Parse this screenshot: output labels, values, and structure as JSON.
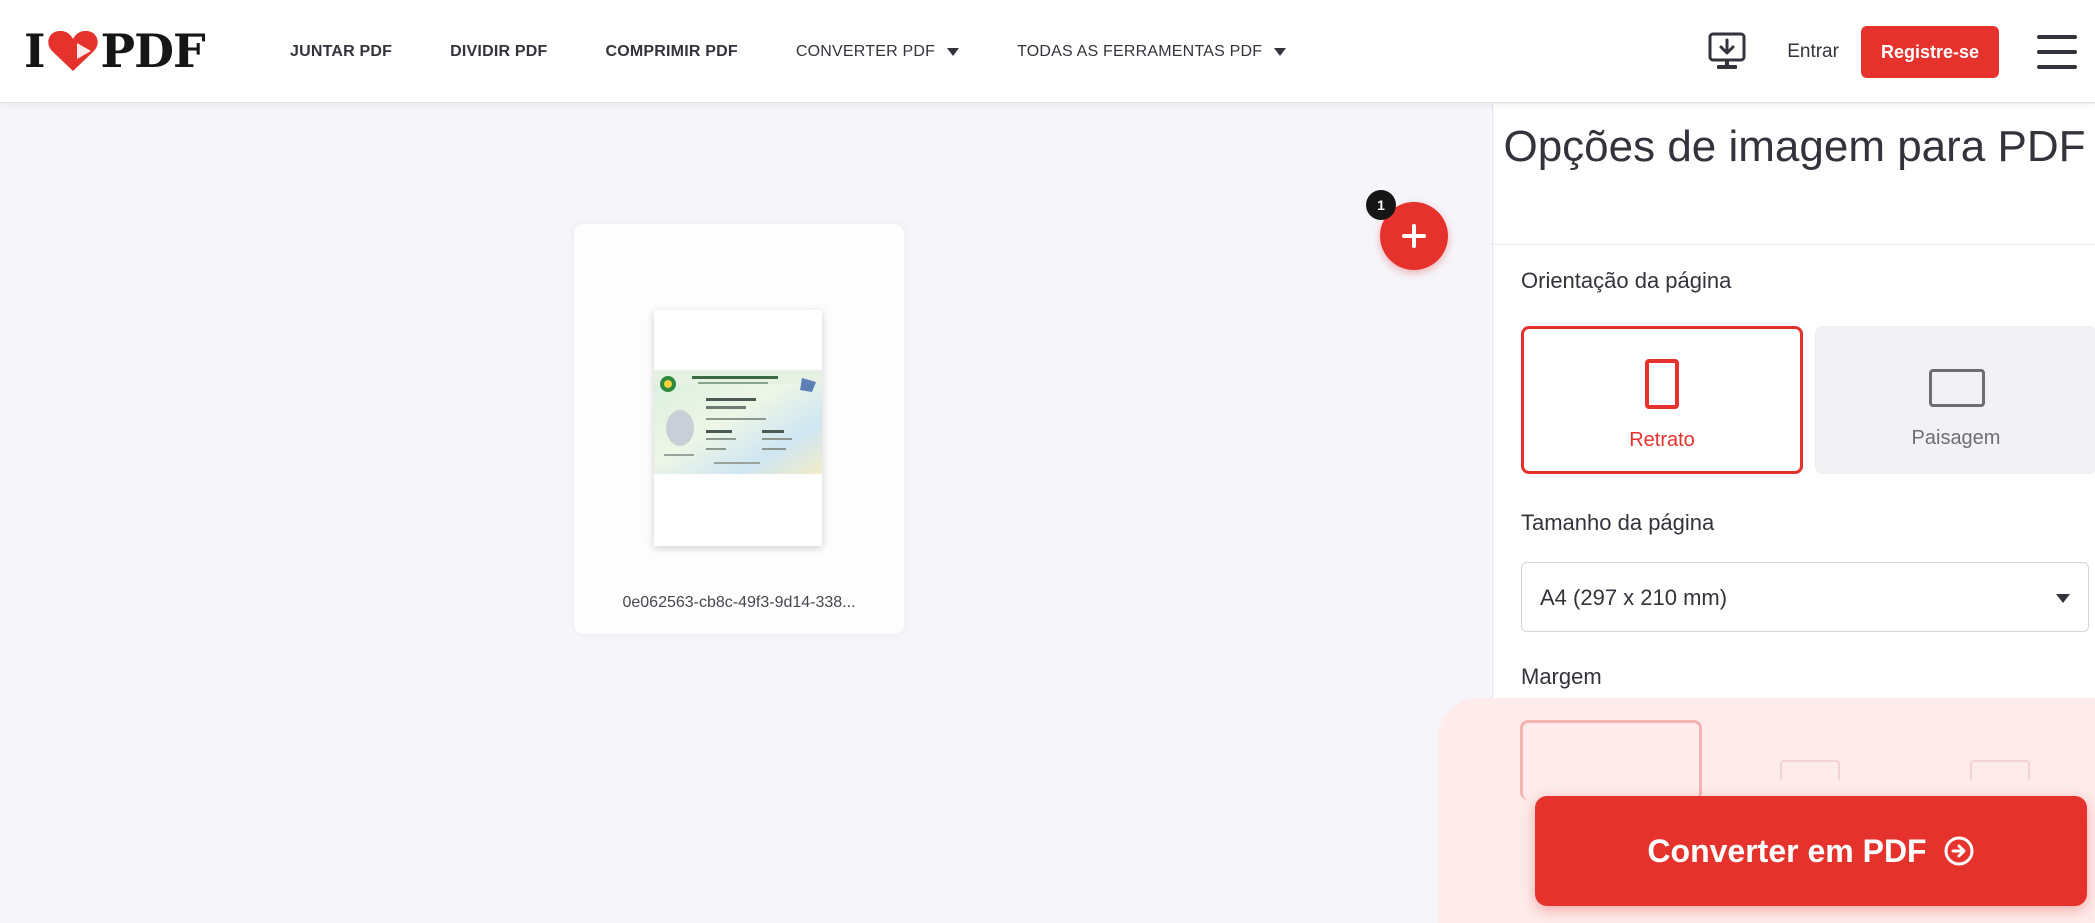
{
  "header": {
    "logo": {
      "left": "I",
      "right": "PDF"
    },
    "nav": [
      {
        "label": "JUNTAR PDF",
        "dropdown": false
      },
      {
        "label": "DIVIDIR PDF",
        "dropdown": false
      },
      {
        "label": "COMPRIMIR PDF",
        "dropdown": false
      },
      {
        "label": "CONVERTER PDF",
        "dropdown": true
      },
      {
        "label": "TODAS AS FERRAMENTAS PDF",
        "dropdown": true
      }
    ],
    "desktop_icon": "desktop-download-icon",
    "login": "Entrar",
    "register": "Registre-se",
    "menu_icon": "hamburger-menu-icon"
  },
  "workspace": {
    "file": {
      "name": "0e062563-cb8c-49f3-9d14-338...",
      "thumbnail": "id-card-document-thumbnail"
    },
    "file_count": "1",
    "add_icon": "plus-icon"
  },
  "sidebar": {
    "title": "Opções de imagem para PDF",
    "orientation": {
      "label": "Orientação da página",
      "options": [
        {
          "label": "Retrato",
          "selected": true,
          "icon": "portrait-page-icon"
        },
        {
          "label": "Paisagem",
          "selected": false,
          "icon": "landscape-page-icon"
        }
      ]
    },
    "page_size": {
      "label": "Tamanho da página",
      "value": "A4 (297 x 210 mm)"
    },
    "margin": {
      "label": "Margem"
    }
  },
  "convert": {
    "label": "Converter em PDF",
    "icon": "arrow-circle-right-icon"
  },
  "colors": {
    "brand": "#e5322d",
    "text": "#33333b",
    "workspace_bg": "#f5f5fa"
  }
}
